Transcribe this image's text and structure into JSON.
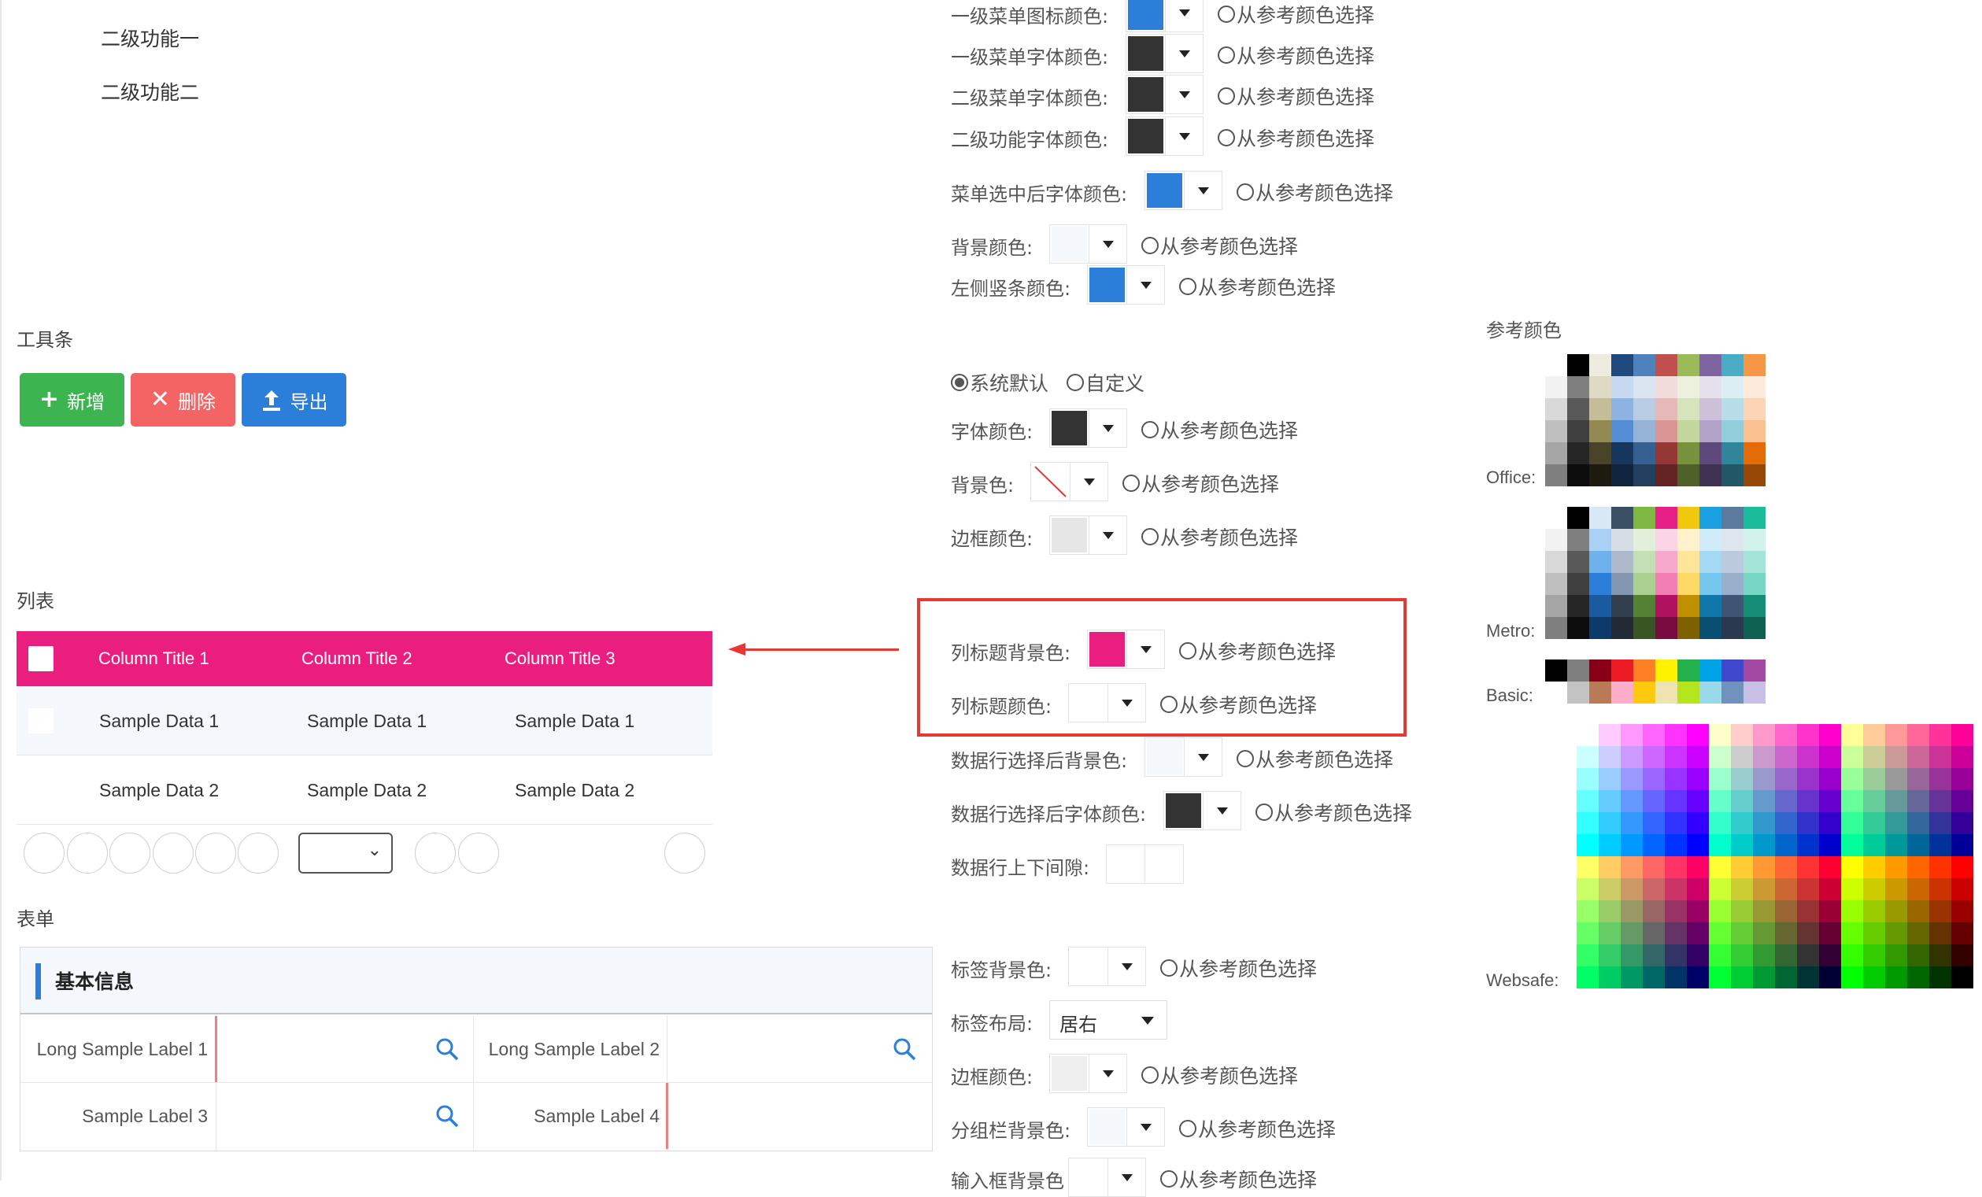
{
  "preview": {
    "submenu": [
      "二级功能一",
      "二级功能二"
    ],
    "toolbar_title": "工具条",
    "buttons": [
      {
        "label": "新增",
        "icon": "plus-icon",
        "color": "#3cb550"
      },
      {
        "label": "删除",
        "icon": "close-icon",
        "color": "#f46464"
      },
      {
        "label": "导出",
        "icon": "upload-icon",
        "color": "#2b7fd8"
      }
    ],
    "list_title": "列表",
    "grid": {
      "header_color": "#e91e7e",
      "columns": [
        "Column Title 1",
        "Column Title 2",
        "Column Title 3"
      ],
      "rows": [
        [
          "Sample Data 1",
          "Sample Data 1",
          "Sample Data 1"
        ],
        [
          "Sample Data 2",
          "Sample Data 2",
          "Sample Data 2"
        ]
      ]
    },
    "form_title": "表单",
    "form": {
      "group_title": "基本信息",
      "labels": [
        "Long Sample Label 1",
        "Long Sample Label 2",
        "Sample Label 3",
        "Sample Label 4"
      ]
    }
  },
  "config": {
    "radio_option": "从参考颜色选择",
    "menu_rows": [
      {
        "label": "一级菜单图标颜色:",
        "color": "#2b7fd8"
      },
      {
        "label": "一级菜单字体颜色:",
        "color": "#333333"
      },
      {
        "label": "二级菜单字体颜色:",
        "color": "#333333"
      },
      {
        "label": "二级功能字体颜色:",
        "color": "#333333"
      },
      {
        "label": "菜单选中后字体颜色:",
        "color": "#2b7fd8"
      },
      {
        "label": "背景颜色:",
        "color": "#f4f8fd"
      },
      {
        "label": "左侧竖条颜色:",
        "color": "#2b7fd8"
      }
    ],
    "mode_options": [
      "系统默认",
      "自定义"
    ],
    "toolbar_rows": [
      {
        "label": "字体颜色:",
        "color": "#333333"
      },
      {
        "label": "背景色:",
        "color": "none"
      },
      {
        "label": "边框颜色:",
        "color": "#e6e6e6"
      }
    ],
    "grid_rows": [
      {
        "label": "列标题背景色:",
        "color": "#e91e7e"
      },
      {
        "label": "列标题颜色:",
        "color": "#ffffff"
      },
      {
        "label": "数据行选择后背景色:",
        "color": "#f4f8fd"
      },
      {
        "label": "数据行选择后字体颜色:",
        "color": "#333333"
      }
    ],
    "row_gap_label": "数据行上下间隙:",
    "form_rows": [
      {
        "label": "标签背景色:",
        "color": "#ffffff"
      },
      {
        "label": "标签布局:",
        "select": "居右"
      },
      {
        "label": "边框颜色:",
        "color": "#efefef"
      },
      {
        "label": "分组栏背景色:",
        "color": "#f4f8fd"
      },
      {
        "label": "输入框背景色",
        "color": "#ffffff"
      }
    ]
  },
  "palettes": {
    "title": "参考颜色",
    "labels": [
      "Office:",
      "Metro:",
      "Basic:",
      "Websafe:"
    ]
  }
}
